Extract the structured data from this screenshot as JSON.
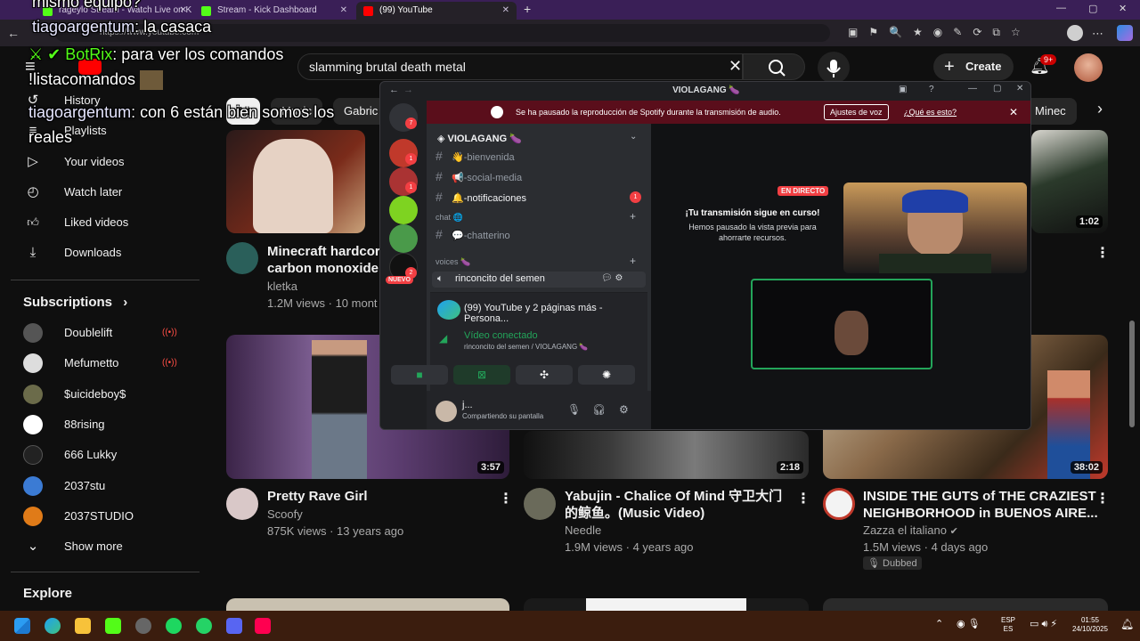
{
  "browser": {
    "tabs": [
      {
        "label": "rageylo Stream - Watch Live on K",
        "active": false,
        "icon_color": "#53fc18"
      },
      {
        "label": "Stream - Kick Dashboard",
        "active": false,
        "icon_color": "#53fc18"
      },
      {
        "label": "(99) YouTube",
        "active": true,
        "icon_color": "#ff0000"
      }
    ],
    "url": "https://www.youtube.com"
  },
  "youtube": {
    "search_query": "slamming brutal death metal",
    "create_label": "Create",
    "notif_count": "9+",
    "chips": [
      "All",
      "Music",
      "Gabric",
      "Minec"
    ],
    "sidebar": {
      "you_items": [
        {
          "icon": "history-icon",
          "label": "History",
          "glyph": "↺"
        },
        {
          "icon": "playlists-icon",
          "label": "Playlists",
          "glyph": "≡"
        },
        {
          "icon": "your-videos-icon",
          "label": "Your videos",
          "glyph": "▷"
        },
        {
          "icon": "watch-later-icon",
          "label": "Watch later",
          "glyph": "◴"
        },
        {
          "icon": "liked-videos-icon",
          "label": "Liked videos",
          "glyph": "👍"
        },
        {
          "icon": "downloads-icon",
          "label": "Downloads",
          "glyph": "⤓"
        }
      ],
      "subscriptions_title": "Subscriptions",
      "subscriptions": [
        {
          "name": "Doublelift",
          "live": true,
          "color": "#555"
        },
        {
          "name": "Mefumetto",
          "live": true,
          "color": "#ddd"
        },
        {
          "name": "$uicideboy$",
          "live": false,
          "color": "#6b6b4a"
        },
        {
          "name": "88rising",
          "live": false,
          "color": "#fff"
        },
        {
          "name": "666 Lukky",
          "live": false,
          "color": "#222"
        },
        {
          "name": "2037stu",
          "live": false,
          "color": "#3b7bd4"
        },
        {
          "name": "2037STUDIO",
          "live": false,
          "color": "#e07b18"
        }
      ],
      "show_more": "Show more",
      "explore": "Explore"
    },
    "videos": [
      {
        "title_line1": "Minecraft hardcore",
        "title_line2": "carbon monoxide",
        "channel": "kletka",
        "meta": "1.2M views · 10 mont"
      },
      {
        "title_line1": "Pretty Rave Girl",
        "title_line2": "",
        "channel": "Scoofy",
        "meta": "875K views · 13 years ago",
        "duration": "3:57"
      },
      {
        "title_line1": "Yabujin - Chalice Of Mind 守卫大门",
        "title_line2": "的鲸鱼。(Music Video)",
        "channel": "Needle",
        "meta": "1.9M views · 4 years ago",
        "duration": "2:18"
      },
      {
        "title_line1": "INSIDE THE GUTS of THE CRAZIEST",
        "title_line2": "NEIGHBORHOOD in BUENOS AIRE...",
        "channel": "Zazza el italiano",
        "meta": "1.5M views · 4 days ago",
        "duration": "38:02",
        "badge": "Dubbed"
      },
      {
        "duration": "1:02"
      }
    ]
  },
  "discord": {
    "window_title": "VIOLAGANG 🍆",
    "banner_text": "Se ha pausado la reproducción de Spotify durante la transmisión de audio.",
    "banner_button": "Ajustes de voz",
    "banner_link": "¿Qué es esto?",
    "server_name": "VIOLAGANG 🍆",
    "guild_badges": [
      "7",
      "1",
      "1",
      "2"
    ],
    "guild_new": "NUEVO",
    "channels": [
      {
        "name": "👋-bienvenida"
      },
      {
        "name": "📢-social-media"
      },
      {
        "name": "🔔-notificaciones",
        "badge": "1"
      }
    ],
    "cat_chat": "chat 🌐",
    "chat_channel": "💬-chatterino",
    "cat_voices": "voices 🍆",
    "voice_channel": "rinconcito del semen",
    "stream_label": "(99) YouTube y 2 páginas más - Persona...",
    "video_connected": "Vídeo conectado",
    "video_sub": "rinconcito del semen / VIOLAGANG 🍆",
    "user_name": "j...",
    "user_status": "Compartiendo su pantalla",
    "live_badge": "EN DIRECTO",
    "paused_title": "¡Tu transmisión sigue en curso!",
    "paused_body1": "Hemos pausado la vista previa para",
    "paused_body2": "ahorrarte recursos."
  },
  "overlay_chat": [
    {
      "text": "mismo equipo?"
    },
    {
      "user": "tiagoargentum",
      "text": "la casaca"
    },
    {
      "user": "BotRix",
      "text": "para ver los comandos"
    },
    {
      "text": "!listacomandos"
    },
    {
      "user": "tiagoargentum",
      "text": "con 6 están bien somos los"
    },
    {
      "text": "reales"
    }
  ],
  "taskbar": {
    "lang": "ESP",
    "lang2": "ES",
    "time": "01:55",
    "date": "24/10/2025"
  }
}
